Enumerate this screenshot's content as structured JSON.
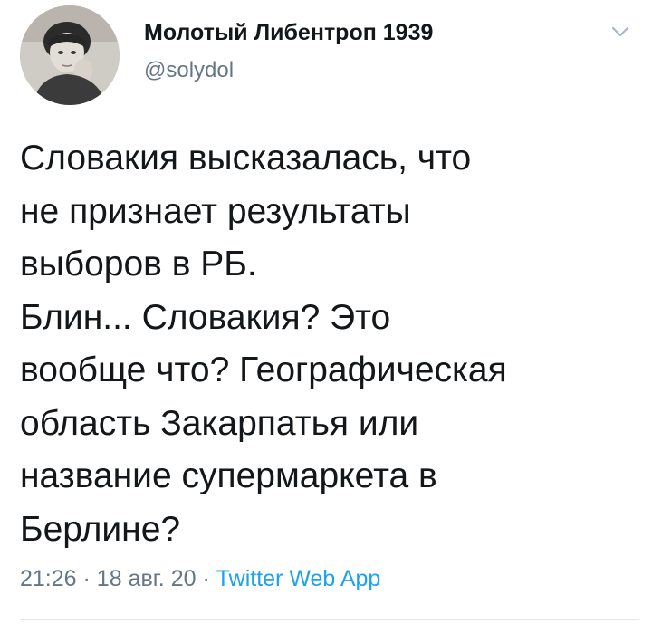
{
  "author": {
    "display_name": "Молотый Либентроп 1939",
    "handle": "@solydol",
    "avatar_icon": "avatar-photo"
  },
  "tweet": {
    "text": "Словакия высказалась, что\nне признает результаты\nвыборов в РБ.\nБлин... Словакия? Это\nвообще что? Географическая\nобласть Закарпатья или\nназвание супермаркета в\nБерлине?",
    "time": "21:26",
    "date": "18 авг. 20",
    "separator": "·",
    "source": "Twitter Web App"
  },
  "colors": {
    "text": "#14171a",
    "secondary": "#657786",
    "link": "#1da1f2",
    "divider": "#e1e8ed"
  },
  "icons": {
    "menu": "chevron-down-icon"
  }
}
